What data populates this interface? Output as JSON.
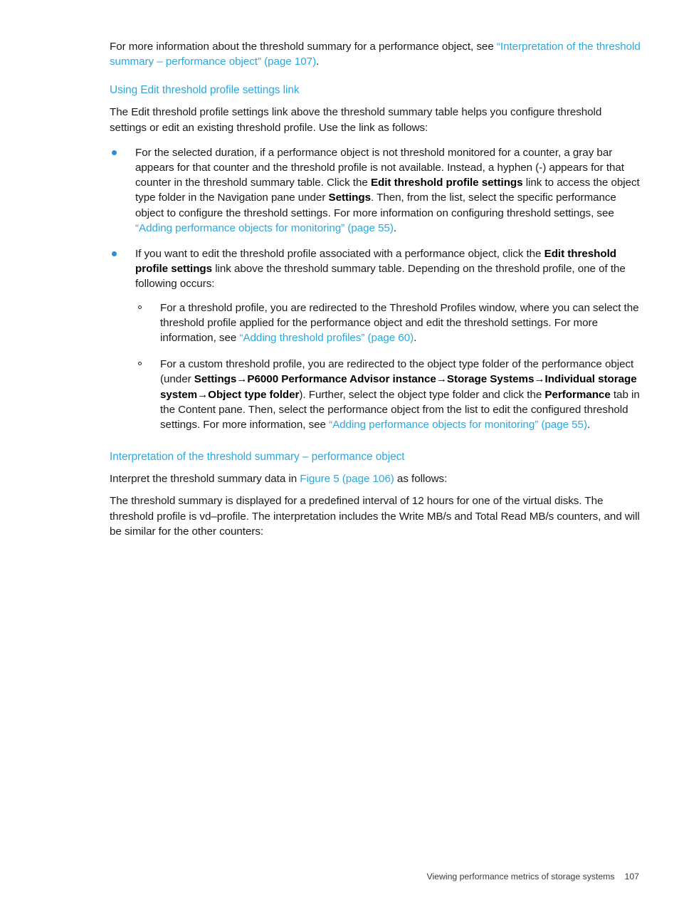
{
  "document": {
    "footer": {
      "running_title": "Viewing performance metrics of storage systems",
      "page_number": "107"
    },
    "colors": {
      "link": "#2BA8E0",
      "heading": "#2BA8E0",
      "bullet": "#2B8FD6",
      "body_text": "#1a1a1a",
      "background": "#ffffff"
    }
  },
  "intro": {
    "text_before_link": "For more information about the threshold summary for a performance object, see ",
    "link": "“Interpretation of the threshold summary – performance object” (page 107)",
    "text_after_link": "."
  },
  "section_using_link": {
    "heading": "Using Edit threshold profile settings link",
    "paragraph": "The Edit threshold profile settings link above the threshold summary table helps you configure threshold settings or edit an existing threshold profile. Use the link as follows:",
    "bullets": [
      {
        "part1": "For the selected duration, if a performance object is not threshold monitored for a counter, a gray bar appears for that counter and the threshold profile is not available. Instead, a hyphen (-) appears for that counter in the threshold summary table. Click the ",
        "bold1": "Edit threshold profile settings",
        "part2": " link to access the object type folder in the Navigation pane under ",
        "bold2": "Settings",
        "part3": ". Then, from the list, select the specific performance object to configure the threshold settings. For more information on configuring threshold settings, see ",
        "link1": "“Adding performance objects for monitoring” (page 55)",
        "part4": "."
      },
      {
        "part1": "If you want to edit the threshold profile associated with a performance object, click the ",
        "bold1": "Edit threshold profile settings",
        "part2": " link above the threshold summary table. Depending on the threshold profile, one of the following occurs:",
        "subbullets": [
          {
            "part1": "For a threshold profile, you are redirected to the Threshold Profiles window, where you can select the threshold profile applied for the performance object and edit the threshold settings. For more information, see ",
            "link1": "“Adding threshold profiles” (page 60)",
            "part2": "."
          },
          {
            "part1": "For a custom threshold profile, you are redirected to the object type folder of the performance object (under ",
            "bold1": "Settings→P6000 Performance Advisor instance→Storage Systems→Individual storage system→Object type folder",
            "part2": "). Further, select the object type folder and click the ",
            "bold2": "Performance",
            "part3": " tab in the Content pane. Then, select the performance object from the list to edit the configured threshold settings. For more information, see ",
            "link1": "“Adding performance objects for monitoring” (page 55)",
            "part4": "."
          }
        ]
      }
    ]
  },
  "section_interpretation": {
    "heading": "Interpretation of the threshold summary – performance object",
    "paragraph1_before_link": "Interpret the threshold summary data in ",
    "paragraph1_link": "Figure 5 (page 106)",
    "paragraph1_after_link": " as follows:",
    "paragraph2": "The threshold summary is displayed for a predefined interval of 12 hours for one of the virtual disks. The threshold profile is vd–profile. The interpretation includes the Write MB/s and Total Read MB/s counters, and will be similar for the other counters:"
  }
}
